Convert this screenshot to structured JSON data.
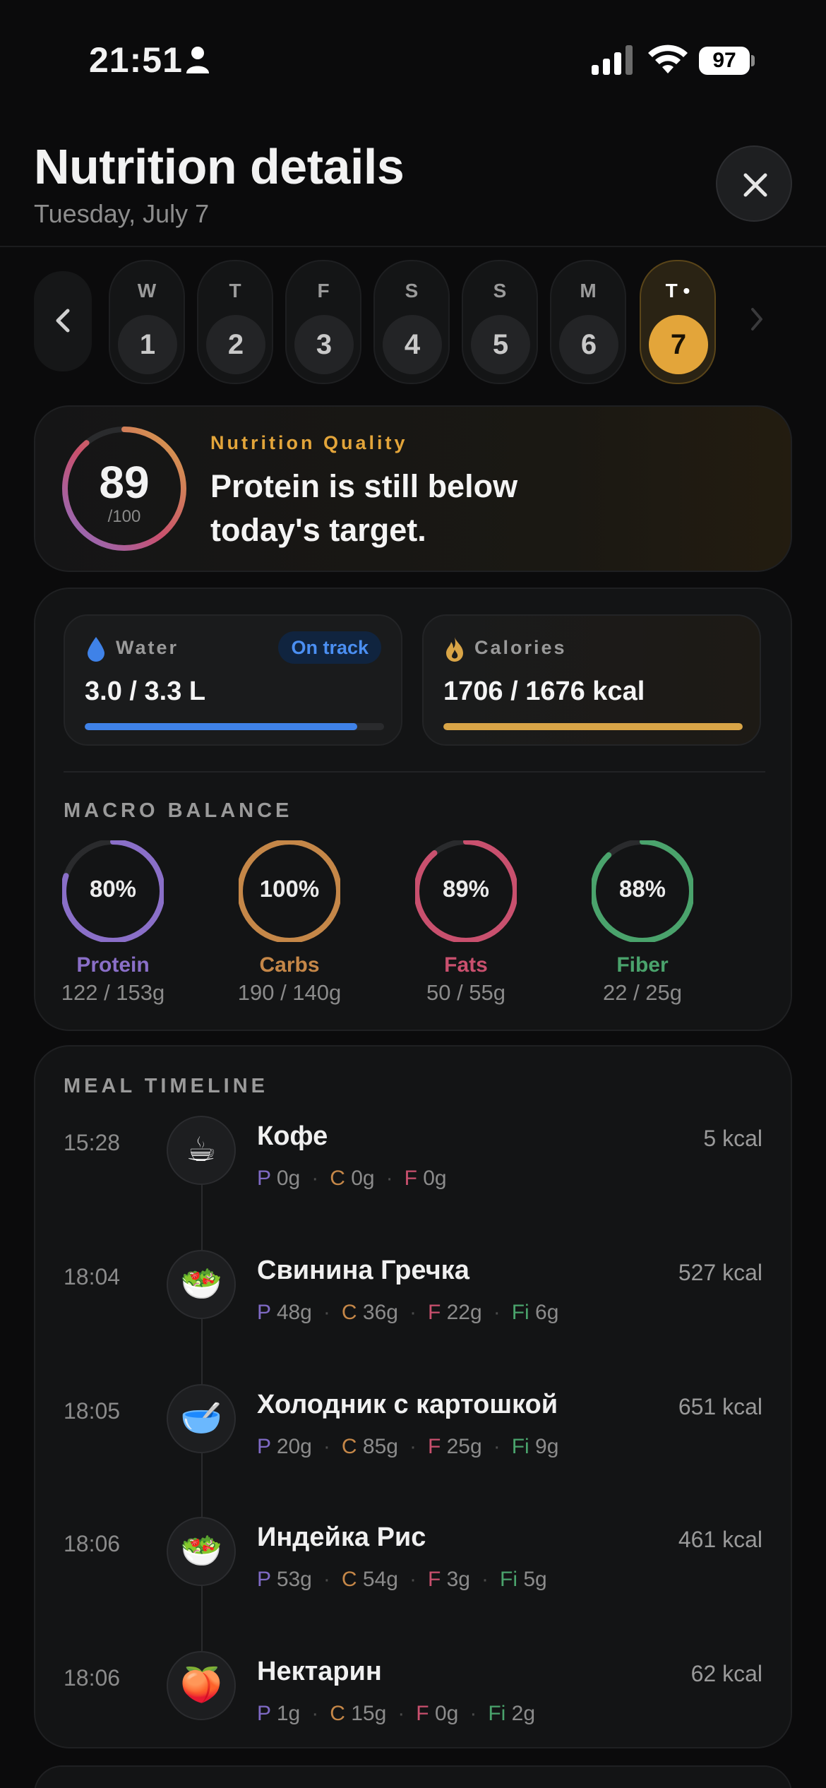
{
  "status_bar": {
    "time": "21:51",
    "battery": "97"
  },
  "header": {
    "title": "Nutrition details",
    "subtitle": "Tuesday, July 7"
  },
  "days": [
    {
      "letter": "W",
      "num": "1"
    },
    {
      "letter": "T",
      "num": "2"
    },
    {
      "letter": "F",
      "num": "3"
    },
    {
      "letter": "S",
      "num": "4"
    },
    {
      "letter": "S",
      "num": "5"
    },
    {
      "letter": "M",
      "num": "6"
    },
    {
      "letter": "T •",
      "num": "7"
    }
  ],
  "quality": {
    "score": "89",
    "max": "/100",
    "score_value": 89,
    "label": "Nutrition Quality",
    "message": "Protein is still below today's target."
  },
  "water": {
    "label": "Water",
    "badge": "On track",
    "value": "3.0 / 3.3 L",
    "progress": 0.91,
    "color": "#3f82e8"
  },
  "calories": {
    "label": "Calories",
    "value": "1706 / 1676 kcal",
    "progress": 1.0,
    "color": "#d9a547"
  },
  "macro_balance": {
    "title": "MACRO BALANCE",
    "items": [
      {
        "pct": "80%",
        "name": "Protein",
        "amount": "122 / 153g",
        "progress": 0.8,
        "color": "#8a6fc8"
      },
      {
        "pct": "100%",
        "name": "Carbs",
        "amount": "190 / 140g",
        "progress": 1.0,
        "color": "#c58748"
      },
      {
        "pct": "89%",
        "name": "Fats",
        "amount": "50 / 55g",
        "progress": 0.89,
        "color": "#c9506e"
      },
      {
        "pct": "88%",
        "name": "Fiber",
        "amount": "22 / 25g",
        "progress": 0.88,
        "color": "#4aa36c"
      }
    ]
  },
  "timeline": {
    "title": "MEAL TIMELINE",
    "meals": [
      {
        "time": "15:28",
        "name": "Кофе",
        "kcal": "5 kcal",
        "icon": "☕",
        "icon_name": "coffee-icon",
        "p": "0g",
        "c": "0g",
        "f": "0g",
        "fi": null
      },
      {
        "time": "18:04",
        "name": "Свинина Гречка",
        "kcal": "527 kcal",
        "icon": "🥗",
        "icon_name": "salad-icon",
        "p": "48g",
        "c": "36g",
        "f": "22g",
        "fi": "6g"
      },
      {
        "time": "18:05",
        "name": "Холодник с картошкой",
        "kcal": "651 kcal",
        "icon": "🥣",
        "icon_name": "soup-bowl-icon",
        "p": "20g",
        "c": "85g",
        "f": "25g",
        "fi": "9g"
      },
      {
        "time": "18:06",
        "name": "Индейка Рис",
        "kcal": "461 kcal",
        "icon": "🥗",
        "icon_name": "salad-icon",
        "p": "53g",
        "c": "54g",
        "f": "3g",
        "fi": "5g"
      },
      {
        "time": "18:06",
        "name": "Нектарин",
        "kcal": "62 kcal",
        "icon": "🍑",
        "icon_name": "nectarine-icon",
        "p": "1g",
        "c": "15g",
        "f": "0g",
        "fi": "2g"
      }
    ]
  }
}
